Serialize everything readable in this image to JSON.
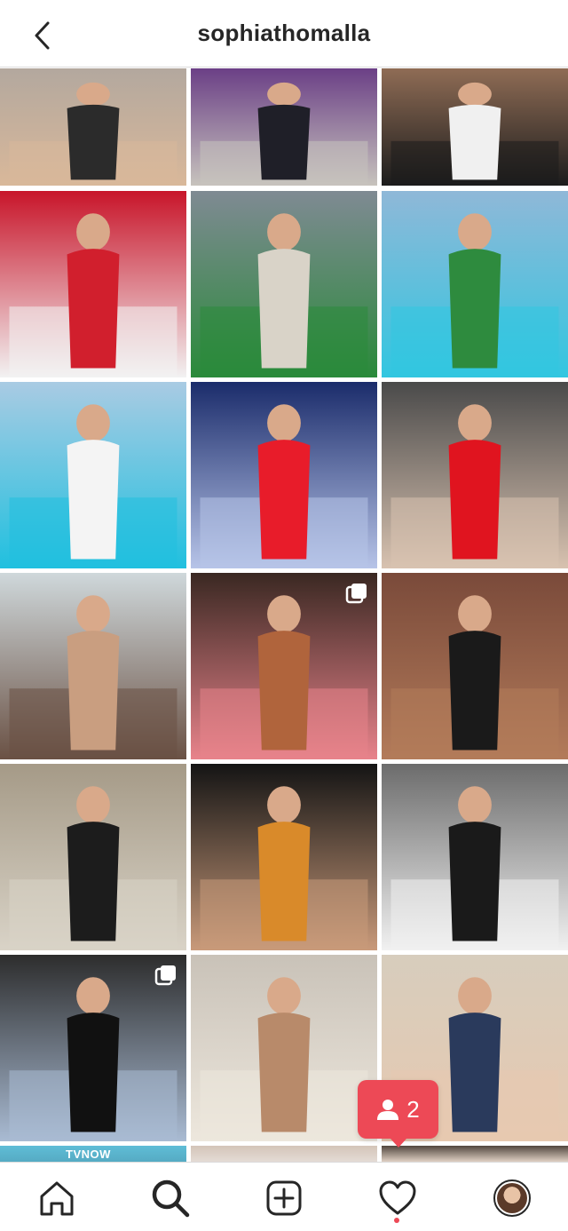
{
  "header": {
    "title": "sophiathomalla",
    "back_icon": "chevron-left-icon"
  },
  "grid": {
    "tiles": [
      {
        "name": "post-1",
        "multi": false,
        "colors": [
          "#b3a89e",
          "#2b2b2b",
          "#d9b89a"
        ]
      },
      {
        "name": "post-2",
        "multi": false,
        "colors": [
          "#6b3f86",
          "#1f1f28",
          "#c7c3bd"
        ]
      },
      {
        "name": "post-3",
        "multi": false,
        "colors": [
          "#8f6c55",
          "#f0f0f0",
          "#1c1c1c"
        ]
      },
      {
        "name": "post-4",
        "multi": false,
        "colors": [
          "#c8152a",
          "#d11f2d",
          "#f2f2f2"
        ]
      },
      {
        "name": "post-5",
        "multi": false,
        "colors": [
          "#7f8a93",
          "#d9d3c8",
          "#2a8a3a"
        ]
      },
      {
        "name": "post-6",
        "multi": false,
        "colors": [
          "#8fb8d8",
          "#2e8b3e",
          "#32c6e0"
        ]
      },
      {
        "name": "post-7",
        "multi": false,
        "colors": [
          "#a9cbe3",
          "#f4f4f4",
          "#20c0df"
        ]
      },
      {
        "name": "post-8",
        "multi": false,
        "colors": [
          "#1b2c6b",
          "#e81c2a",
          "#b7c4e8"
        ]
      },
      {
        "name": "post-9",
        "multi": false,
        "colors": [
          "#4a4a4a",
          "#e0141f",
          "#d8c2b0"
        ]
      },
      {
        "name": "post-10",
        "multi": false,
        "colors": [
          "#cfd8db",
          "#c99e80",
          "#6a5144"
        ]
      },
      {
        "name": "post-11",
        "multi": true,
        "colors": [
          "#3a2822",
          "#b0643c",
          "#e8838b"
        ]
      },
      {
        "name": "post-12",
        "multi": false,
        "colors": [
          "#7a4a3a",
          "#1a1a1a",
          "#b37b5a"
        ]
      },
      {
        "name": "post-13",
        "multi": false,
        "colors": [
          "#a59a87",
          "#1c1c1c",
          "#d9d3c7"
        ]
      },
      {
        "name": "post-14",
        "multi": false,
        "colors": [
          "#141414",
          "#d98a2a",
          "#c99a7a"
        ]
      },
      {
        "name": "post-15",
        "multi": false,
        "colors": [
          "#6c6c6c",
          "#1a1a1a",
          "#f1f1f1"
        ]
      },
      {
        "name": "post-16",
        "multi": true,
        "colors": [
          "#2d2d2d",
          "#111111",
          "#a9bbd3"
        ]
      },
      {
        "name": "post-17",
        "multi": false,
        "colors": [
          "#c9c2b8",
          "#b88a6a",
          "#ede7dd"
        ]
      },
      {
        "name": "post-18",
        "multi": false,
        "colors": [
          "#d7cdbd",
          "#2a3a5c",
          "#e7c9b0"
        ]
      },
      {
        "name": "post-19",
        "multi": false,
        "colors": [
          "#2aa7c9",
          "#ffffff",
          "#1d8fb0"
        ]
      },
      {
        "name": "post-20",
        "multi": false,
        "colors": [
          "#d8d0c8",
          "#c9a58a",
          "#eeeeee"
        ]
      },
      {
        "name": "post-21",
        "multi": false,
        "colors": [
          "#2a2a2a",
          "#c79a7c",
          "#e8e2dc"
        ]
      }
    ],
    "overlay_text": "TVNOW",
    "multi_icon": "multiple-posts-icon"
  },
  "notification": {
    "count": "2",
    "icon": "person-icon",
    "color": "#ed4956"
  },
  "bottom_nav": {
    "items": [
      {
        "name": "home",
        "icon": "home-icon"
      },
      {
        "name": "search",
        "icon": "search-icon",
        "active": true
      },
      {
        "name": "new-post",
        "icon": "plus-square-icon"
      },
      {
        "name": "activity",
        "icon": "heart-icon",
        "has_dot": true
      },
      {
        "name": "profile",
        "icon": "avatar"
      }
    ]
  }
}
